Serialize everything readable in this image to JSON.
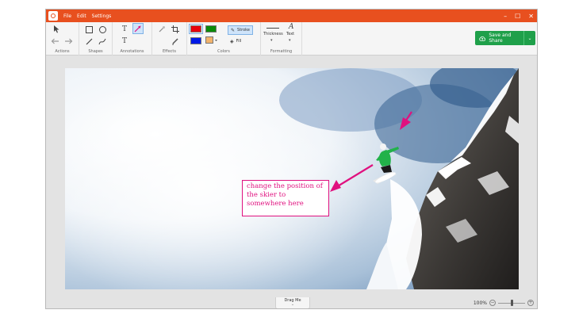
{
  "menu": [
    "File",
    "Edit",
    "Settings"
  ],
  "window_controls": [
    "–",
    "☐",
    "✕"
  ],
  "ribbon": {
    "groups": [
      "Actions",
      "Shapes",
      "Annotations",
      "Effects",
      "Colors",
      "Formatting"
    ],
    "tools": {
      "text": "T",
      "text_small": "T",
      "font": "A"
    },
    "color_options": [
      "Stroke",
      "Fill"
    ],
    "formatting": [
      "Thickness",
      "Text"
    ],
    "colors": {
      "red": "#e8000b",
      "green": "#0a8a0a",
      "blue": "#0019e6",
      "accent": "#e8501f",
      "save": "#1fa04a",
      "annotation": "#e0117f"
    }
  },
  "save_button": "Save and Share",
  "callout_text": "change the position of the skier to somewhere here",
  "statusbar": {
    "drag_label": "Drag Me",
    "zoom": "100%",
    "zoom_level": 0.5
  }
}
